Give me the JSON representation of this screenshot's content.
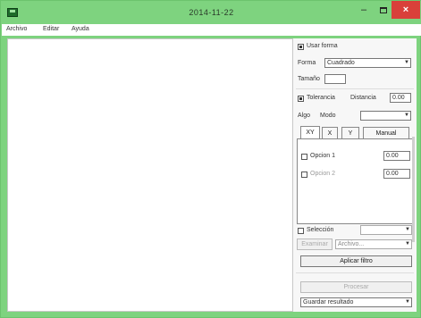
{
  "window": {
    "title": "2014-11-22"
  },
  "menu": {
    "items": [
      "Archivo",
      "Editar",
      "Ayuda"
    ]
  },
  "panel": {
    "use_shape_label": "Usar forma",
    "use_shape_checked": true,
    "shape_label": "Forma",
    "shape_value": "Cuadrado",
    "size_label": "Tamaño",
    "size_value": "",
    "tolerance_label": "Tolerancia",
    "tolerance_checked": true,
    "tolerance_sub_label": "Distancia",
    "tolerance_value": "0.00",
    "algo_label": "Algo",
    "algo_sub_label": "Modo",
    "algo_value": "",
    "tabs": [
      "XY",
      "X",
      "Y",
      "Manual"
    ],
    "opt1_label": "Opcion 1",
    "opt1_value": "0.00",
    "opt2_label": "Opcion 2",
    "opt2_value": "0.00",
    "select_label": "Selección",
    "browse_label": "Examinar",
    "file_value": "Archivo...",
    "apply_button": "Aplicar filtro",
    "process_button": "Procesar",
    "output_value": "Guardar resultado"
  }
}
